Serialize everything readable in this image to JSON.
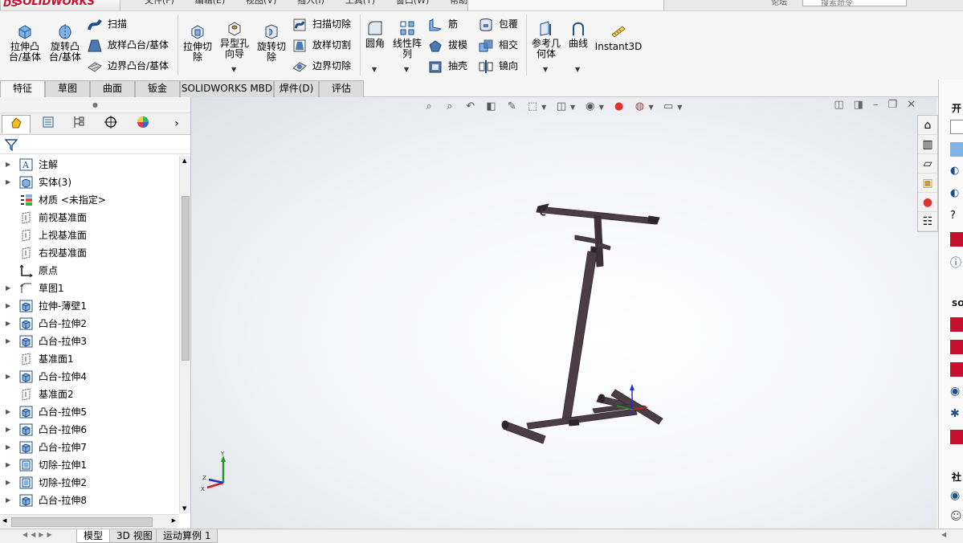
{
  "app": {
    "logo": "SOLIDWORKS",
    "logo_mark": "DS"
  },
  "menus": [
    "文件(F)",
    "编辑(E)",
    "视图(V)",
    "插入(I)",
    "工具(T)",
    "窗口(W)",
    "帮助(H)"
  ],
  "search": {
    "placeholder": "搜索命令",
    "user_label": "论坛"
  },
  "ribbon": {
    "extrude_boss": "拉伸凸\n台/基体",
    "revolve_boss": "旋转凸\n台/基体",
    "sweep": "扫描",
    "loft_boss": "放样凸台/基体",
    "boundary_boss": "边界凸台/基体",
    "extrude_cut": "拉伸切\n除",
    "hole_wizard": "异型孔\n向导",
    "revolve_cut": "旋转切\n除",
    "sweep_cut": "扫描切除",
    "loft_cut": "放样切割",
    "boundary_cut": "边界切除",
    "fillet": "圆角",
    "linear_pattern": "线性阵\n列",
    "rib": "筋",
    "draft": "拔模",
    "shell": "抽壳",
    "wrap": "包覆",
    "intersect": "相交",
    "mirror": "镜向",
    "ref_geometry": "参考几\n何体",
    "curves": "曲线",
    "instant3d": "Instant3D"
  },
  "tabs": [
    "特征",
    "草图",
    "曲面",
    "钣金",
    "SOLIDWORKS MBD",
    "焊件(D)",
    "评估"
  ],
  "tree": [
    {
      "label": "注解",
      "icon": "annotation-icon",
      "expandable": true
    },
    {
      "label": "实体(3)",
      "icon": "solid-bodies-icon",
      "expandable": true
    },
    {
      "label": "材质 <未指定>",
      "icon": "material-icon",
      "expandable": false
    },
    {
      "label": "前视基准面",
      "icon": "plane-icon",
      "expandable": false
    },
    {
      "label": "上视基准面",
      "icon": "plane-icon",
      "expandable": false
    },
    {
      "label": "右视基准面",
      "icon": "plane-icon",
      "expandable": false
    },
    {
      "label": "原点",
      "icon": "origin-icon",
      "expandable": false
    },
    {
      "label": "草图1",
      "icon": "sketch-icon",
      "expandable": true
    },
    {
      "label": "拉伸-薄壁1",
      "icon": "extrude-feature-icon",
      "expandable": true
    },
    {
      "label": "凸台-拉伸2",
      "icon": "extrude-feature-icon",
      "expandable": true
    },
    {
      "label": "凸台-拉伸3",
      "icon": "extrude-feature-icon",
      "expandable": true
    },
    {
      "label": "基准面1",
      "icon": "plane-icon",
      "expandable": false
    },
    {
      "label": "凸台-拉伸4",
      "icon": "extrude-feature-icon",
      "expandable": true
    },
    {
      "label": "基准面2",
      "icon": "plane-icon",
      "expandable": false
    },
    {
      "label": "凸台-拉伸5",
      "icon": "extrude-feature-icon",
      "expandable": true
    },
    {
      "label": "凸台-拉伸6",
      "icon": "extrude-feature-icon",
      "expandable": true
    },
    {
      "label": "凸台-拉伸7",
      "icon": "extrude-feature-icon",
      "expandable": true
    },
    {
      "label": "切除-拉伸1",
      "icon": "cut-feature-icon",
      "expandable": true
    },
    {
      "label": "切除-拉伸2",
      "icon": "cut-feature-icon",
      "expandable": true
    },
    {
      "label": "凸台-拉伸8",
      "icon": "extrude-feature-icon",
      "expandable": true
    }
  ],
  "bottom_tabs": [
    "模型",
    "3D 视图",
    "运动算例 1"
  ],
  "rightpane": {
    "header": "开",
    "sol": "SOL",
    "community": "社"
  },
  "colors": {
    "accent": "#c8102e",
    "model": "#3b2f35",
    "axis_x": "#d22020",
    "axis_y": "#1e9a2a",
    "axis_z": "#2030d0"
  }
}
